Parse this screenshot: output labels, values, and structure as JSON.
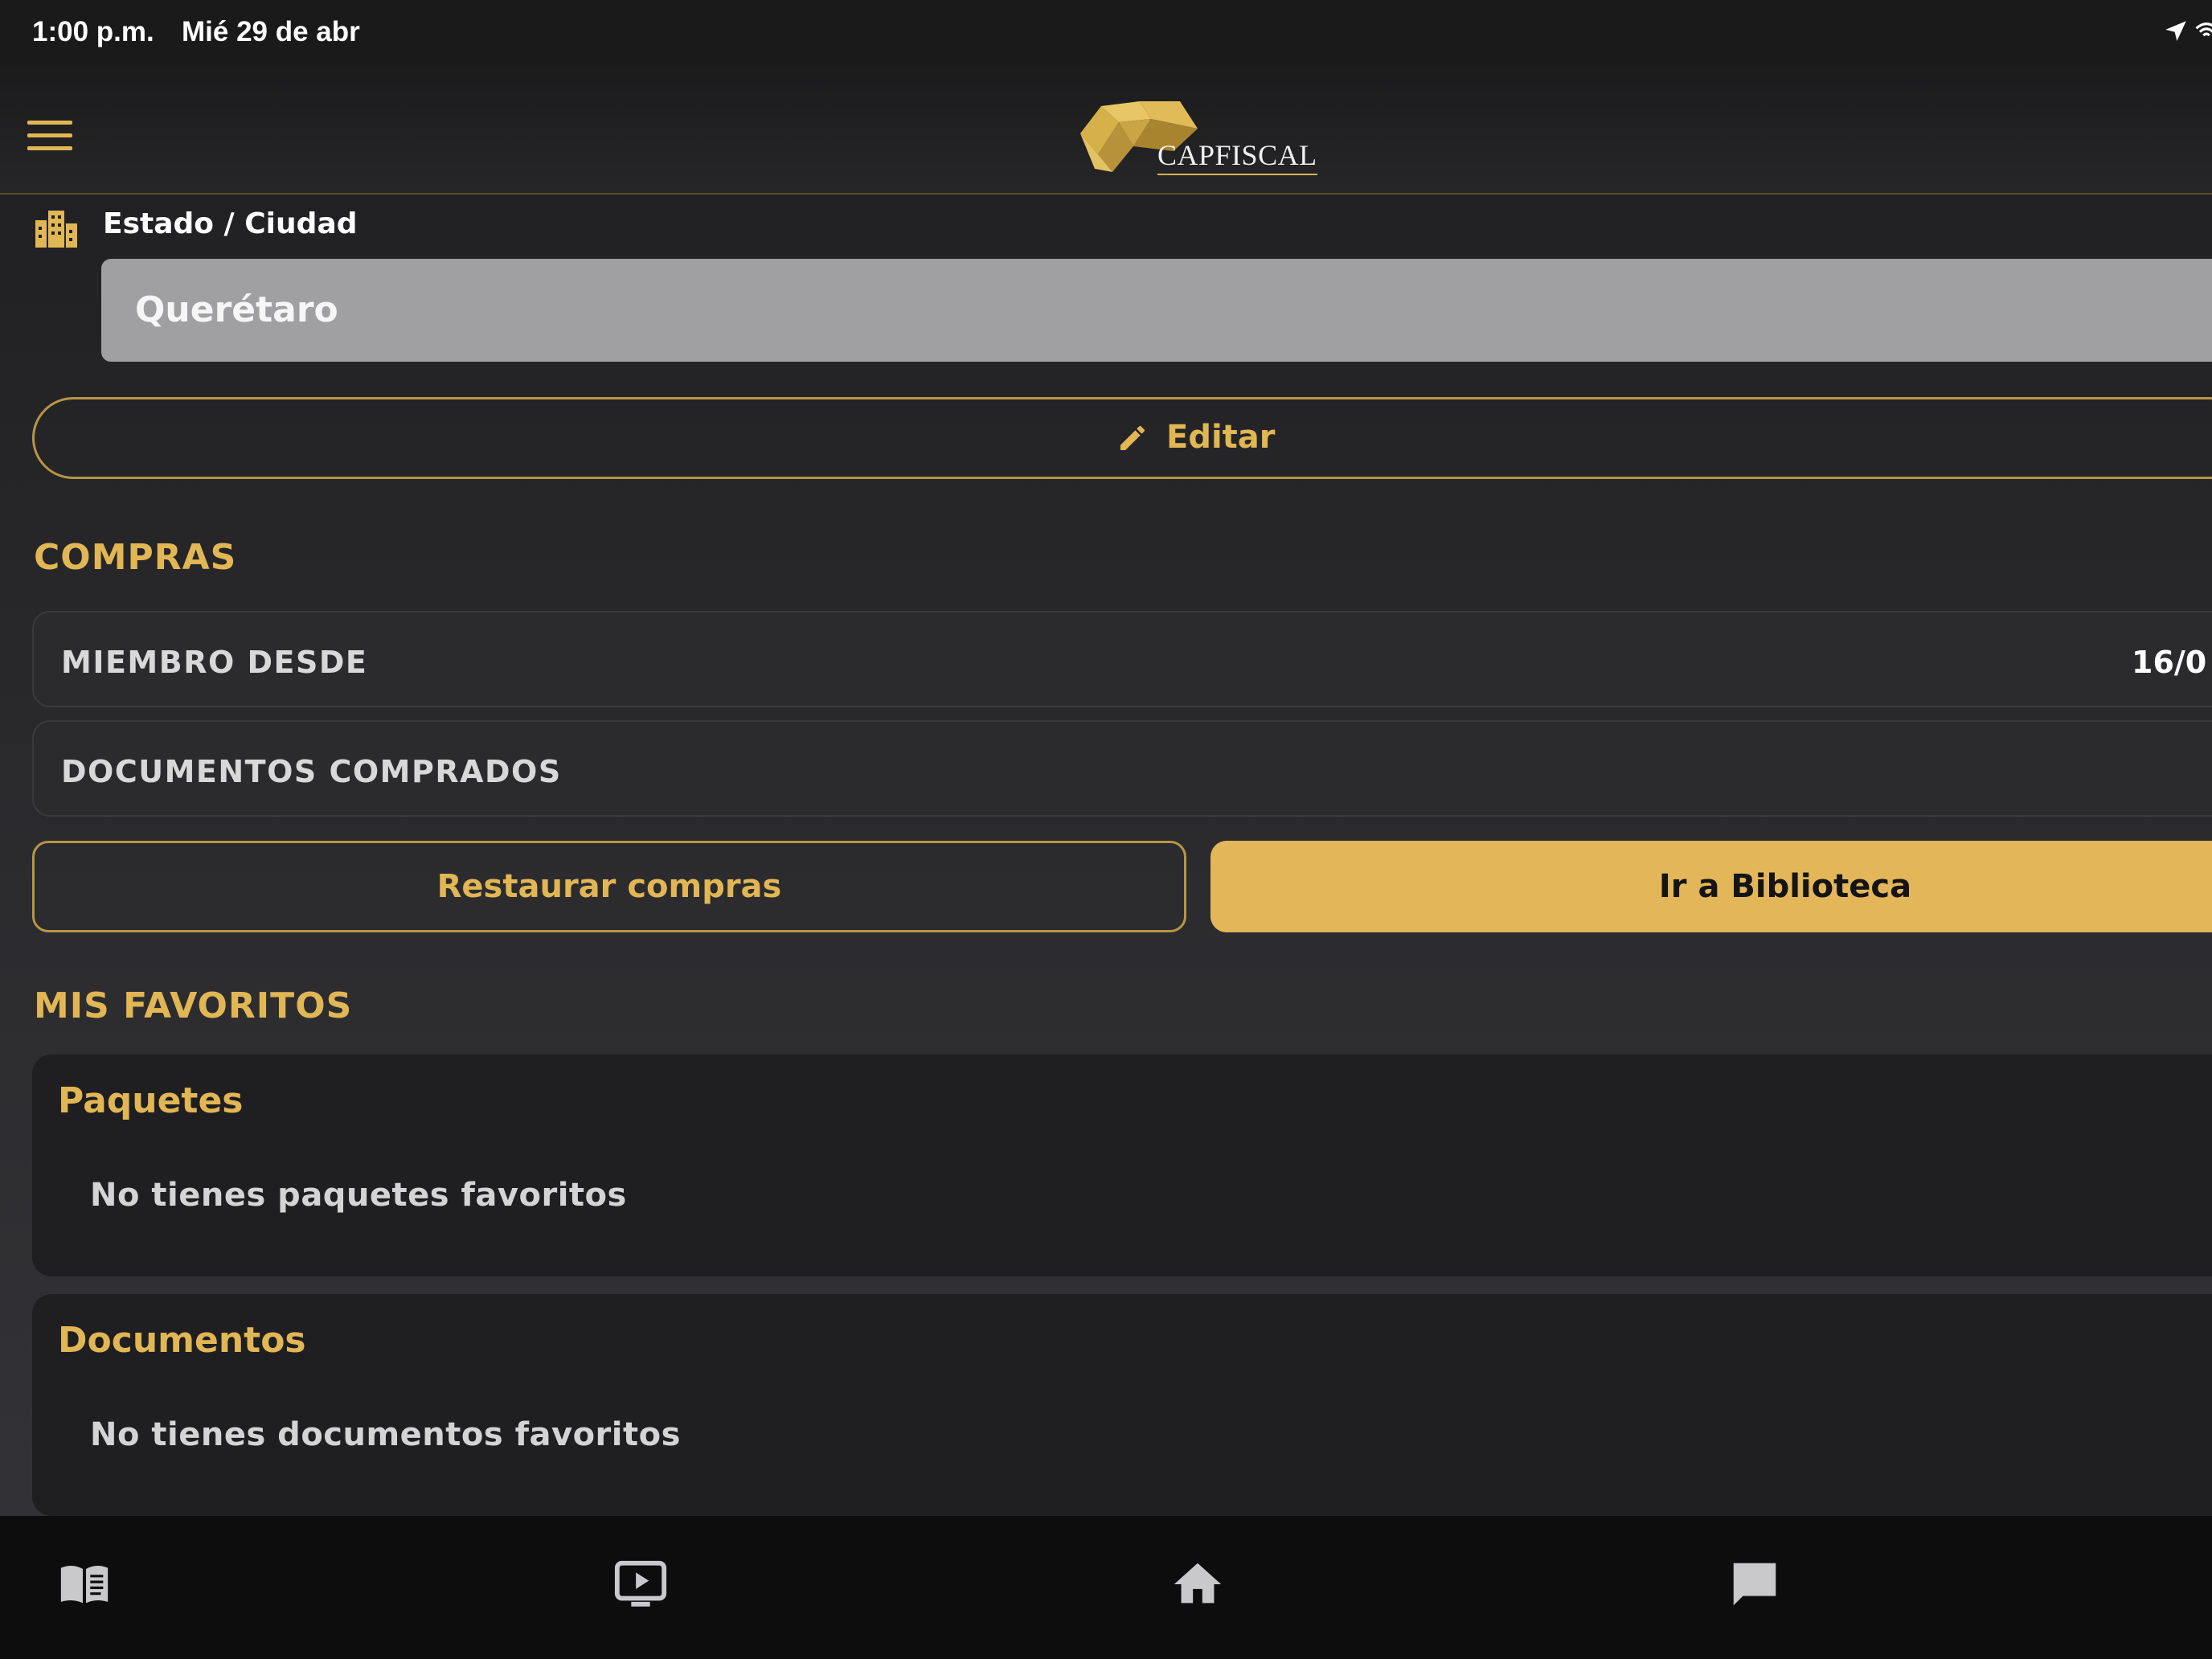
{
  "status_bar": {
    "time": "1:00 p.m.",
    "date": "Mié 29 de abr",
    "icons": [
      "location-arrow-icon",
      "wifi-icon"
    ]
  },
  "header": {
    "logo_text": "CAPFISCAL",
    "menu_icon": "hamburger-menu-icon"
  },
  "location": {
    "icon": "city-buildings-icon",
    "label": "Estado / Ciudad",
    "value": "Querétaro",
    "edit_label": "Editar",
    "edit_icon": "pencil-icon"
  },
  "purchases": {
    "title": "COMPRAS",
    "rows": [
      {
        "key": "MIEMBRO DESDE",
        "value": "16/0"
      },
      {
        "key": "DOCUMENTOS COMPRADOS",
        "value": ""
      }
    ],
    "restore_label": "Restaurar compras",
    "library_label": "Ir a Biblioteca"
  },
  "favorites": {
    "title": "MIS FAVORITOS",
    "cards": [
      {
        "title": "Paquetes",
        "empty_text": "No tienes paquetes favoritos"
      },
      {
        "title": "Documentos",
        "empty_text": "No tienes documentos favoritos"
      }
    ]
  },
  "tab_bar": {
    "tabs": [
      {
        "icon": "book-icon"
      },
      {
        "icon": "video-play-icon"
      },
      {
        "icon": "home-icon"
      },
      {
        "icon": "chat-bubble-icon"
      }
    ]
  },
  "colors": {
    "accent": "#e3b65a",
    "background": "#2b2b2e",
    "card": "#1f1f21",
    "tab_bar": "#0d0d0e"
  }
}
